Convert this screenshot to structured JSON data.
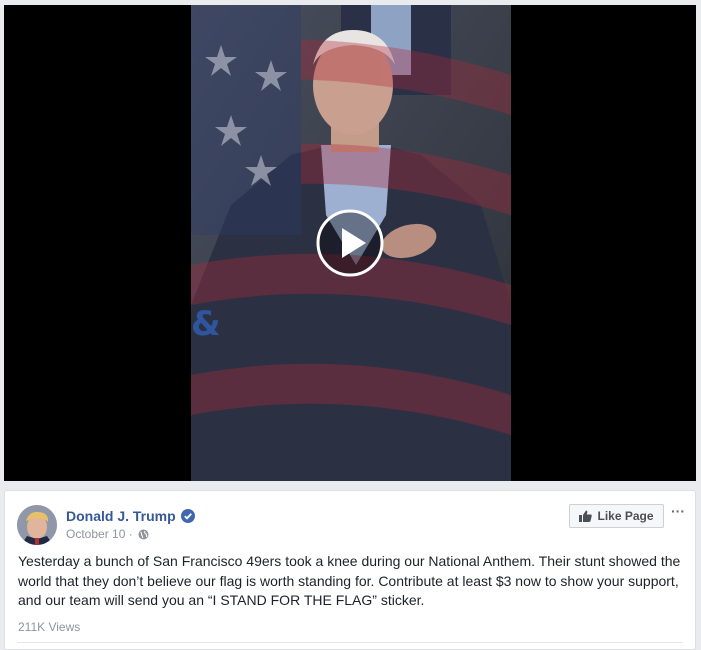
{
  "video": {
    "play_icon": "play-circle-icon"
  },
  "post": {
    "author": "Donald J. Trump",
    "verified_icon": "verified-badge-icon",
    "date": "October 10",
    "separator": "·",
    "privacy_icon": "globe-icon",
    "like_page_label": "Like Page",
    "like_icon": "thumbs-up-icon",
    "more_label": "···",
    "text": "Yesterday a bunch of San Francisco 49ers took a knee during our National Anthem. Their stunt showed the world that they don’t believe our flag is worth standing for. Contribute at least $3 now to show your support, and our team will send you an “I STAND FOR THE FLAG” sticker.",
    "views": "211K Views"
  },
  "colors": {
    "link": "#365899",
    "verified": "#4267b2",
    "text": "#1d2129",
    "meta": "#90949c"
  }
}
